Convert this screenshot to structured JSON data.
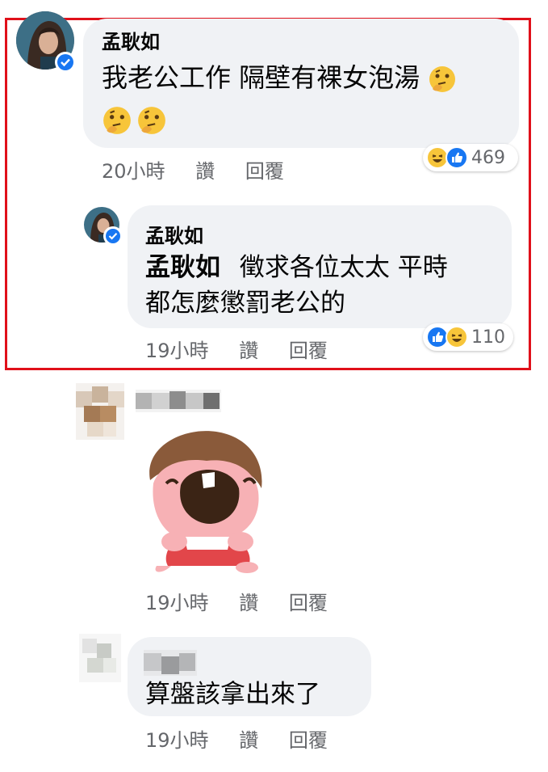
{
  "comments": [
    {
      "author": "孟耿如",
      "text_line1": "我老公工作 隔壁有裸女泡湯",
      "time": "20小時",
      "like_label": "讚",
      "reply_label": "回覆",
      "reaction_count": "469",
      "reactions": [
        "haha-icon",
        "like-icon"
      ]
    },
    {
      "author": "孟耿如",
      "mention": "孟耿如",
      "text_line1": "徵求各位太太 平時",
      "text_line2": "都怎麼懲罰老公的",
      "time": "19小時",
      "like_label": "讚",
      "reply_label": "回覆",
      "reaction_count": "110",
      "reactions": [
        "like-icon",
        "haha-icon"
      ]
    },
    {
      "time": "19小時",
      "like_label": "讚",
      "reply_label": "回覆"
    },
    {
      "text": "算盤該拿出來了",
      "time": "19小時",
      "like_label": "讚",
      "reply_label": "回覆"
    }
  ],
  "colors": {
    "highlight": "#e0101a",
    "bubble": "#f0f2f5",
    "meta_text": "#65676b",
    "like_blue": "#1877f2",
    "haha_yellow": "#f7c53a"
  }
}
